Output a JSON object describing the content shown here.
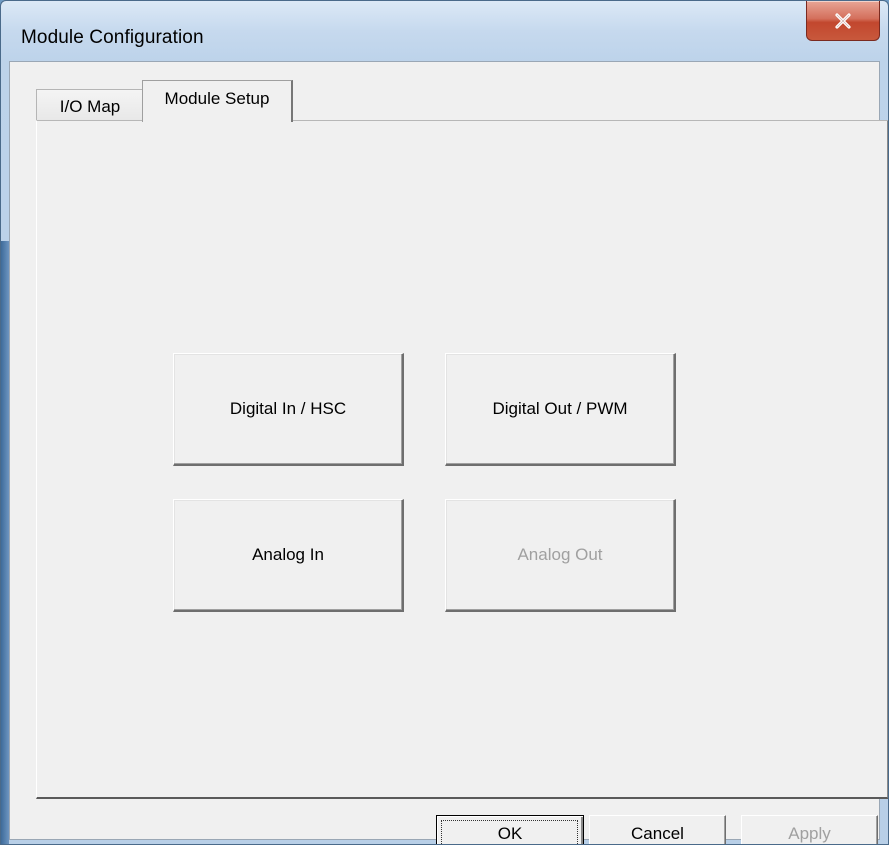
{
  "window": {
    "title": "Module Configuration",
    "close_icon": "close-x-icon",
    "colors": {
      "close_button": "#c8583c",
      "title_bar": "#c6d9ee",
      "client_background": "#f0f0f0",
      "disabled_text": "#a0a0a0"
    }
  },
  "tabs": [
    {
      "label": "I/O Map",
      "selected": false
    },
    {
      "label": "Module Setup",
      "selected": true
    }
  ],
  "module_setup": {
    "buttons": [
      {
        "label": "Digital In / HSC",
        "enabled": true
      },
      {
        "label": "Digital Out / PWM",
        "enabled": true
      },
      {
        "label": "Analog In",
        "enabled": true
      },
      {
        "label": "Analog Out",
        "enabled": false
      }
    ]
  },
  "dialog_buttons": {
    "ok": {
      "label": "OK",
      "enabled": true,
      "default": true
    },
    "cancel": {
      "label": "Cancel",
      "enabled": true
    },
    "apply": {
      "label": "Apply",
      "enabled": false
    }
  }
}
